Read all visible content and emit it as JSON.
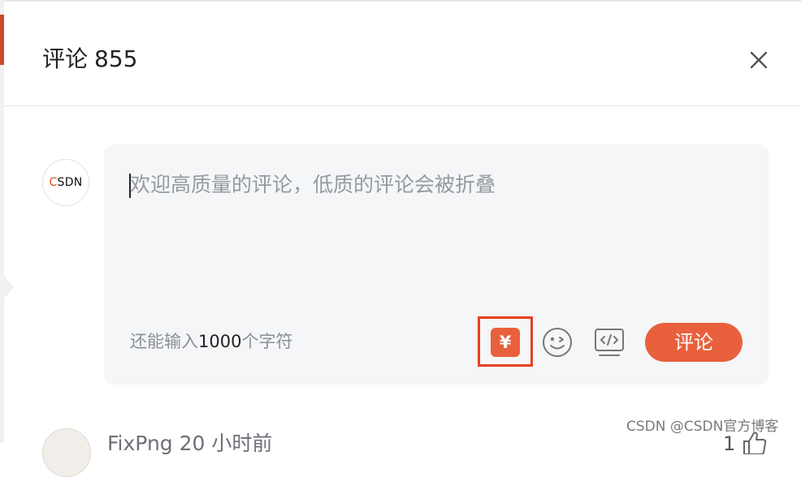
{
  "header": {
    "title": "评论",
    "count": "855"
  },
  "avatar": {
    "brand_c": "C",
    "brand_rest": "SDN"
  },
  "editor": {
    "placeholder": "欢迎高质量的评论，低质的评论会被折叠",
    "char_count_prefix": "还能输入",
    "char_count_value": "1000",
    "char_count_suffix": "个字符"
  },
  "toolbar": {
    "reward_glyph": "¥",
    "emoji_icon": "emoji-icon",
    "code_icon": "code-icon",
    "submit_label": "评论"
  },
  "next_comment": {
    "username": "FixPng",
    "time": "20 小时前",
    "likes": "1"
  },
  "watermark": "CSDN @CSDN官方博客",
  "colors": {
    "accent": "#e9603d",
    "highlight_box": "#e5401f",
    "editor_bg": "#f5f6f7"
  }
}
